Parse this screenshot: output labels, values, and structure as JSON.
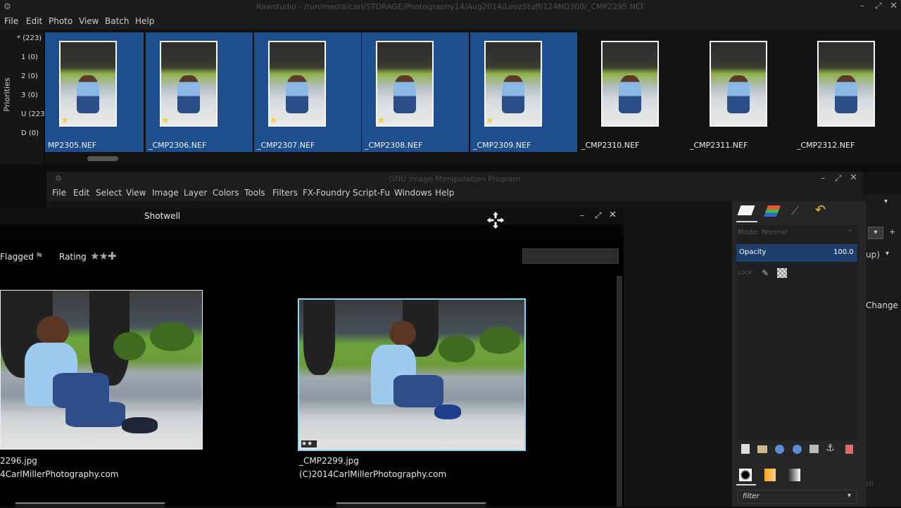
{
  "rawstudio": {
    "title": "Rawstudio - /run/media/carl/STORAGE/Photography14/Aug2014/LeozStuff/124ND300/_CMP2295.NEF",
    "menu": [
      "File",
      "Edit",
      "Photo",
      "View",
      "Batch",
      "Help"
    ],
    "priorities_label": "Priorities",
    "priorities": [
      {
        "key": "*",
        "count": "(223)"
      },
      {
        "key": "1",
        "count": "(0)"
      },
      {
        "key": "2",
        "count": "(0)"
      },
      {
        "key": "3",
        "count": "(0)"
      },
      {
        "key": "U",
        "count": "(223)"
      },
      {
        "key": "D",
        "count": "(0)"
      }
    ],
    "thumbnails": [
      {
        "name": "MP2305.NEF",
        "selected": true,
        "starred": true
      },
      {
        "name": "_CMP2306.NEF",
        "selected": true,
        "starred": true
      },
      {
        "name": "_CMP2307.NEF",
        "selected": true,
        "starred": true
      },
      {
        "name": "_CMP2308.NEF",
        "selected": true,
        "starred": true
      },
      {
        "name": "_CMP2309.NEF",
        "selected": true,
        "starred": true
      },
      {
        "name": "_CMP2310.NEF",
        "selected": false,
        "starred": false
      },
      {
        "name": "_CMP2311.NEF",
        "selected": false,
        "starred": false
      },
      {
        "name": "_CMP2312.NEF",
        "selected": false,
        "starred": false
      }
    ],
    "accent": "#1e4f8c"
  },
  "gimp": {
    "title": "GNU Image Manipulation Program",
    "menu": [
      "File",
      "Edit",
      "Select",
      "View",
      "Image",
      "Layer",
      "Colors",
      "Tools",
      "Filters",
      "FX-Foundry",
      "Script-Fu",
      "Windows",
      "Help"
    ],
    "layers": {
      "mode_label": "Mode:",
      "mode_value": "Normal",
      "opacity_label": "Opacity",
      "opacity_value": "100.0",
      "lock_label": "Lock:",
      "filter_placeholder": "filter"
    },
    "side_labels": {
      "up": "up)",
      "change": "Change",
      "all": "all"
    }
  },
  "shotwell": {
    "title": "Shotwell",
    "flagged_label": "Flagged",
    "rating_label": "Rating",
    "photos": [
      {
        "filename": "2296.jpg",
        "copyright": "4CarlMillerPhotography.com"
      },
      {
        "filename": "_CMP2299.jpg",
        "copyright": "(C)2014CarlMillerPhotography.com",
        "stars": "★★"
      }
    ]
  }
}
